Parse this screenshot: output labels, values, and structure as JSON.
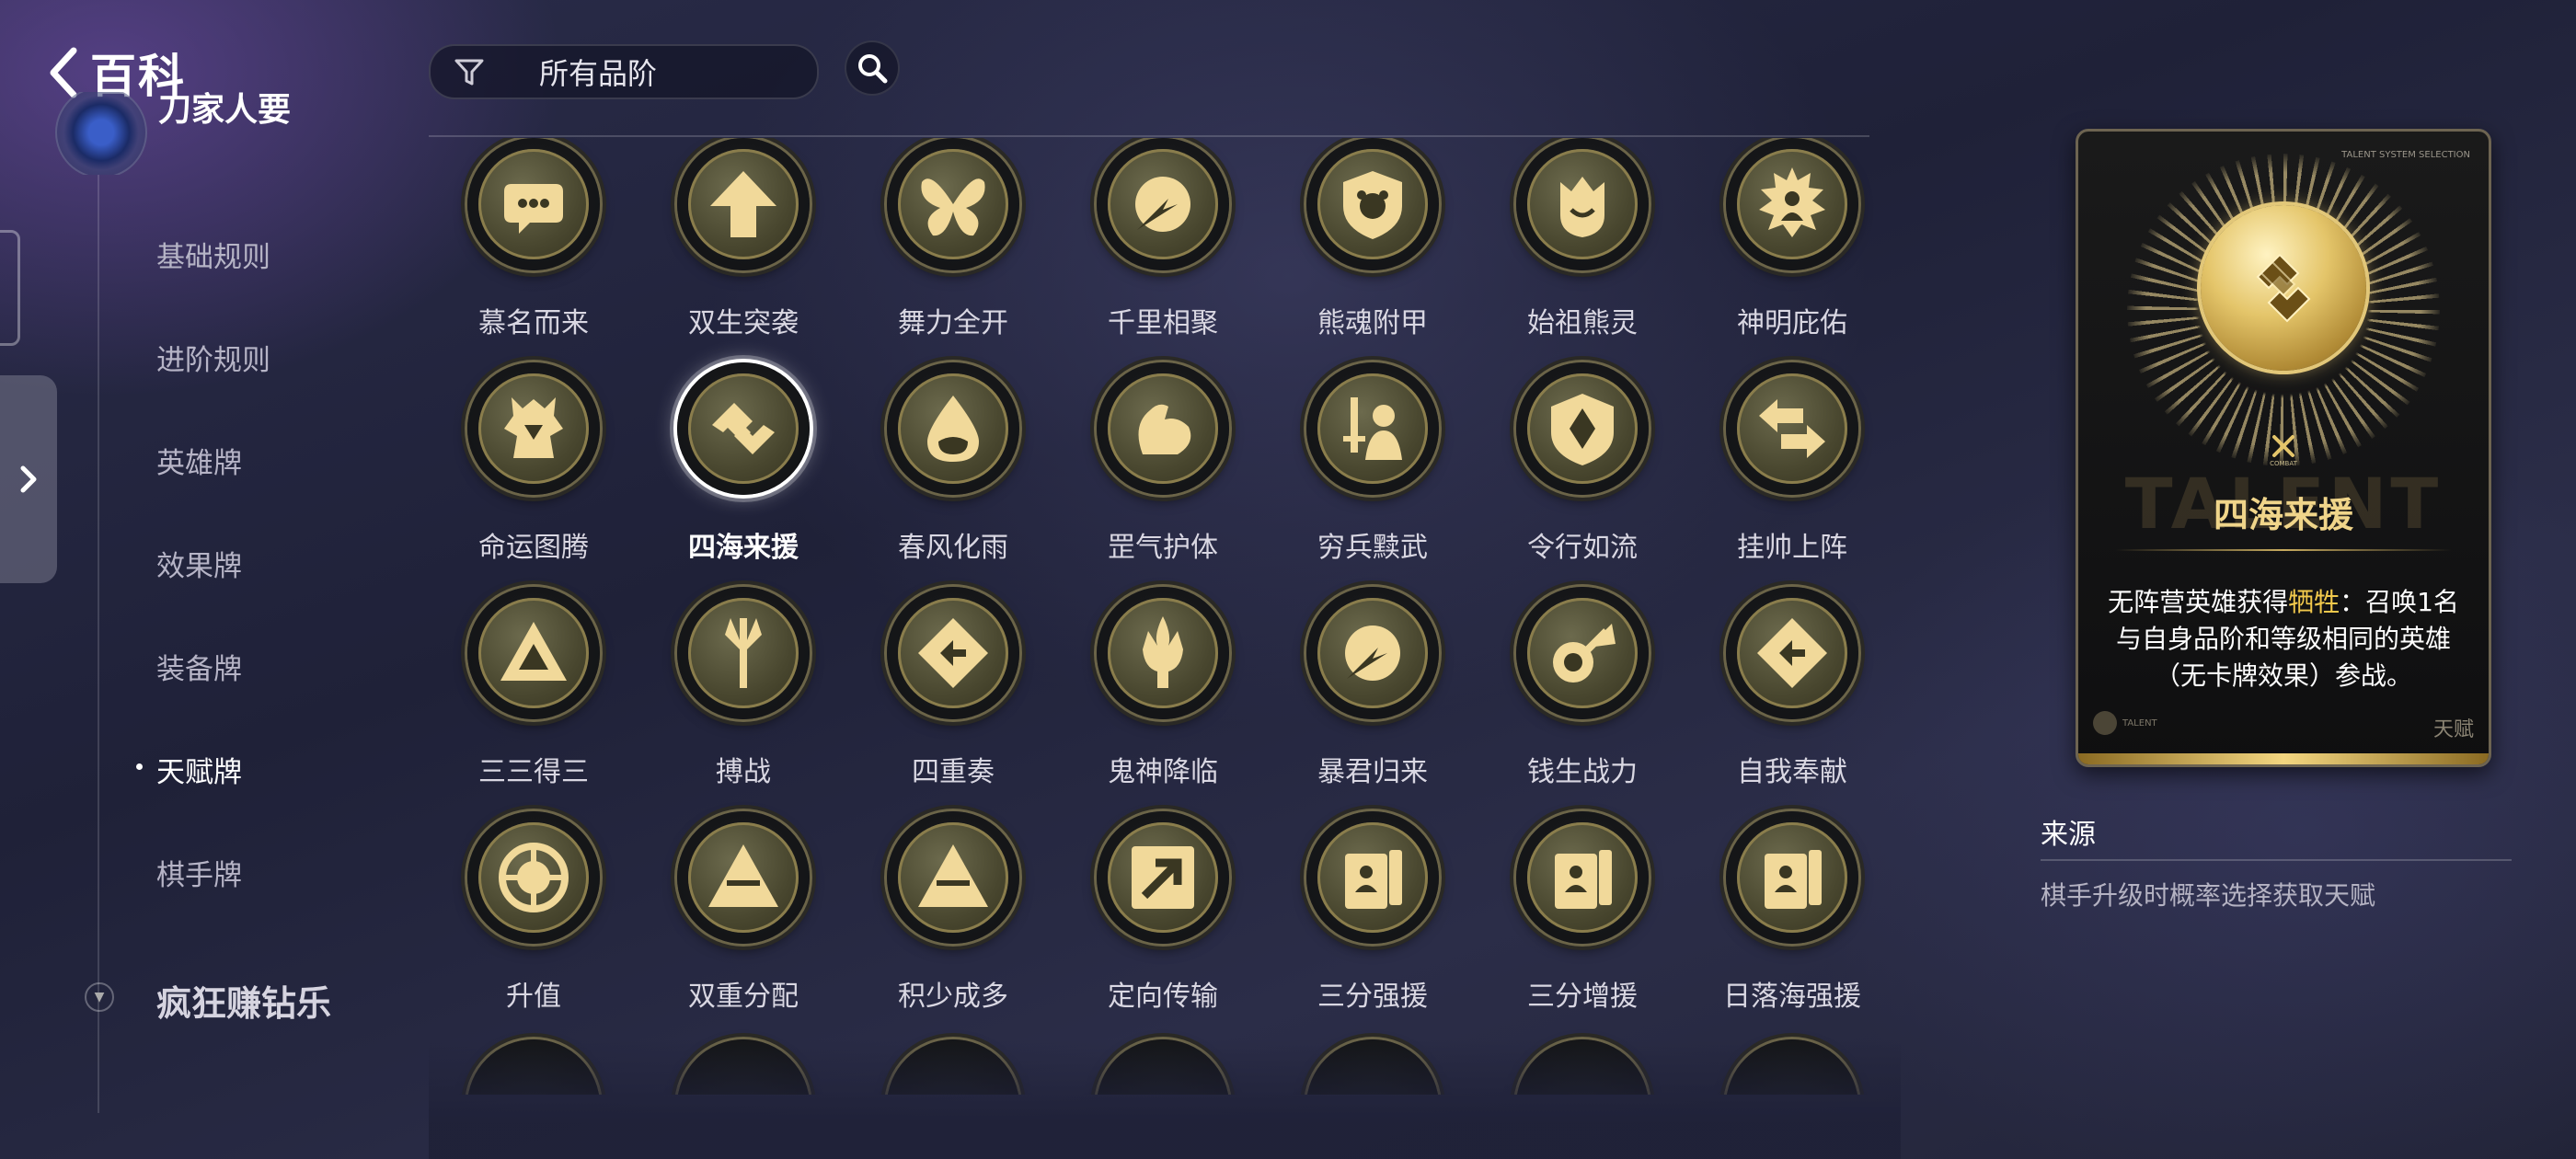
{
  "header": {
    "back_label": "百科",
    "filter_label": "所有品阶"
  },
  "sidebar": {
    "section_title": "刀家人要",
    "items": [
      {
        "label": "基础规则",
        "active": false
      },
      {
        "label": "进阶规则",
        "active": false
      },
      {
        "label": "英雄牌",
        "active": false
      },
      {
        "label": "效果牌",
        "active": false
      },
      {
        "label": "装备牌",
        "active": false
      },
      {
        "label": "天赋牌",
        "active": true
      },
      {
        "label": "棋手牌",
        "active": false
      }
    ],
    "section2_title": "疯狂赚钻乐"
  },
  "talents": [
    {
      "name": "慕名而来",
      "icon": "speech-bubble"
    },
    {
      "name": "双生突袭",
      "icon": "arrow-up"
    },
    {
      "name": "舞力全开",
      "icon": "butterfly"
    },
    {
      "name": "千里相聚",
      "icon": "comet"
    },
    {
      "name": "熊魂附甲",
      "icon": "bear-shield"
    },
    {
      "name": "始祖熊灵",
      "icon": "bear-crown"
    },
    {
      "name": "神明庇佑",
      "icon": "sun-figure"
    },
    {
      "name": "命运图腾",
      "icon": "totem"
    },
    {
      "name": "四海来援",
      "icon": "interlock",
      "selected": true
    },
    {
      "name": "春风化雨",
      "icon": "droplet"
    },
    {
      "name": "罡气护体",
      "icon": "muscle-arm"
    },
    {
      "name": "穷兵黩武",
      "icon": "soldier-sword"
    },
    {
      "name": "令行如流",
      "icon": "badge-shield"
    },
    {
      "name": "挂帅上阵",
      "icon": "swap-arrows"
    },
    {
      "name": "三三得三",
      "icon": "triangle-cycle"
    },
    {
      "name": "搏战",
      "icon": "trident"
    },
    {
      "name": "四重奏",
      "icon": "diamond-arrows"
    },
    {
      "name": "鬼神降临",
      "icon": "trident-flame"
    },
    {
      "name": "暴君归来",
      "icon": "comet"
    },
    {
      "name": "钱生战力",
      "icon": "coin-arrow"
    },
    {
      "name": "自我奉献",
      "icon": "diamond-arrows"
    },
    {
      "name": "升值",
      "icon": "target-arrow"
    },
    {
      "name": "双重分配",
      "icon": "pyramid"
    },
    {
      "name": "积少成多",
      "icon": "pyramid"
    },
    {
      "name": "定向传输",
      "icon": "arrow-box"
    },
    {
      "name": "三分强援",
      "icon": "cards"
    },
    {
      "name": "三分增援",
      "icon": "cards"
    },
    {
      "name": "日落海强援",
      "icon": "cards"
    }
  ],
  "detail": {
    "card_corner": "TALENT SYSTEM SELECTION",
    "card_type": "COMBAT",
    "card_bg_word": "TALENT",
    "title": "四海来援",
    "desc_before": "无阵营英雄获得",
    "desc_highlight": "牺牲",
    "desc_after": "：召唤1名与自身品阶和等级相同的英雄（无卡牌效果）参战。",
    "footer_left": "TALENT",
    "footer_right": "天赋",
    "source_heading": "来源",
    "source_text": "棋手升级时概率选择获取天赋"
  },
  "colors": {
    "gold": "#e4c56a",
    "highlight": "#f2c94c",
    "background": "#22243a"
  }
}
